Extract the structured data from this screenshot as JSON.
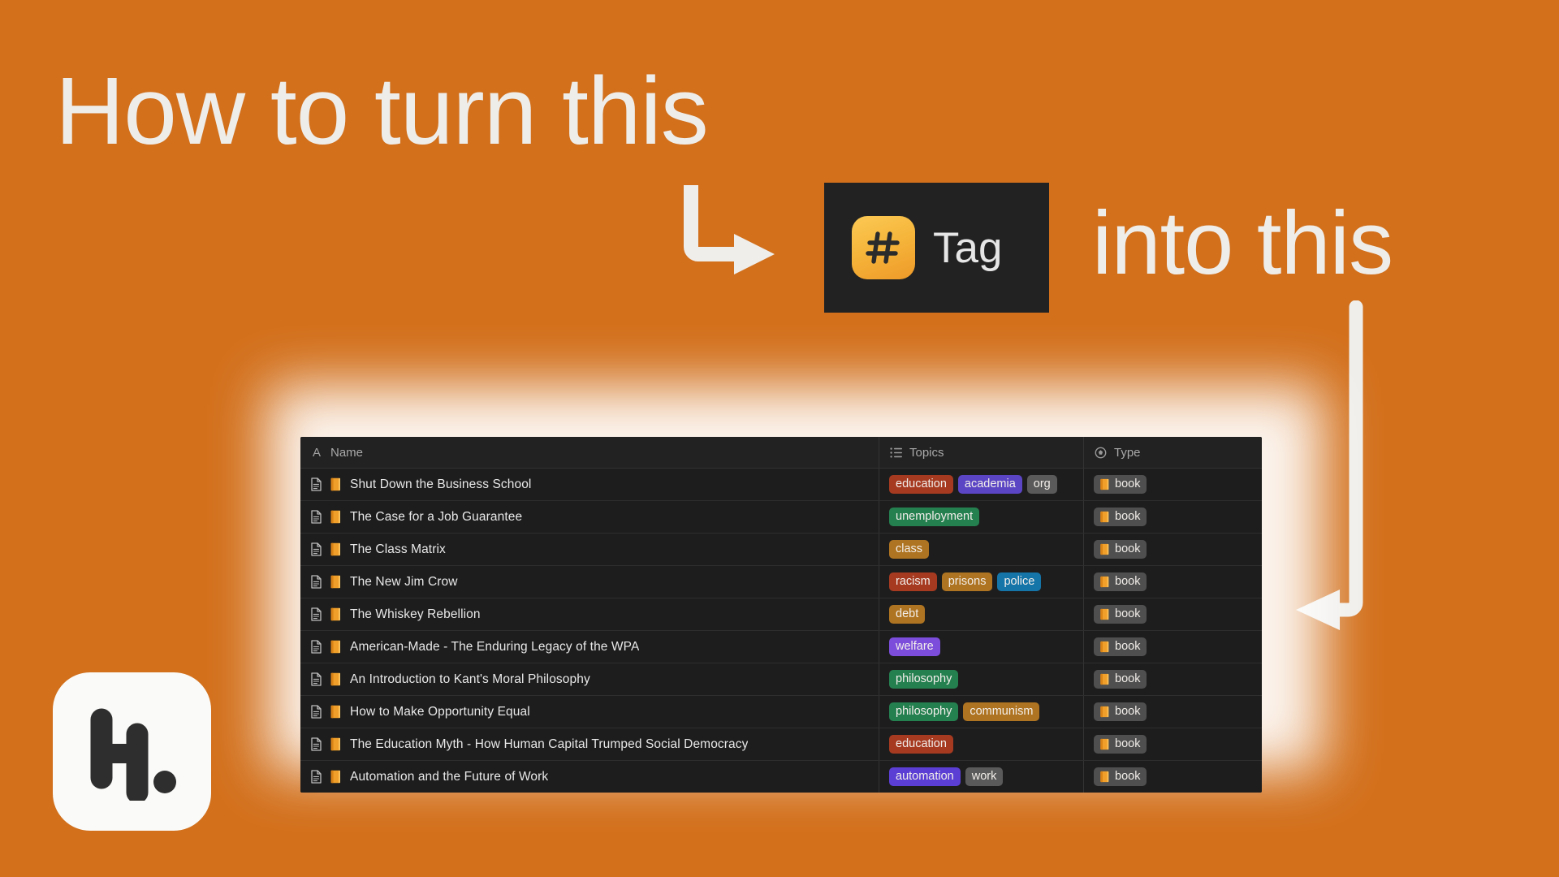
{
  "canvas": {
    "background_color": "#D2701C",
    "title_text_color": "#EFEDEA"
  },
  "headline": {
    "left": "How to turn this",
    "right": "into this"
  },
  "arrows": {
    "left_arrow_name": "elbow-arrow-down-right",
    "right_arrow_name": "elbow-arrow-down-left",
    "color": "#F0EEEB"
  },
  "tag_badge": {
    "icon": "hash-icon",
    "icon_symbol": "#",
    "label": "Tag",
    "chip_bg": "#222222",
    "icon_bg_start": "#FBC954",
    "icon_bg_end": "#EE9A28"
  },
  "logo": {
    "name": "h-dot-logo",
    "letter": "H",
    "dot": ".",
    "bg": "#FAFAF8",
    "fg": "#2E2E2E"
  },
  "table": {
    "columns": [
      {
        "label": "Name",
        "icon": "text-letter-a-icon",
        "type": "title"
      },
      {
        "label": "Topics",
        "icon": "multi-select-icon",
        "type": "multi_select"
      },
      {
        "label": "Type",
        "icon": "select-target-icon",
        "type": "select"
      }
    ],
    "rows": [
      {
        "page_icon": "page-icon",
        "emoji": "closed-book-emoji",
        "name": "Shut Down the Business School",
        "topics": [
          {
            "label": "education",
            "color": "#A63A21"
          },
          {
            "label": "academia",
            "color": "#5B45C4"
          },
          {
            "label": "org",
            "color": "#5A5A5A",
            "truncated": true
          }
        ],
        "type": {
          "label": "book",
          "emoji": "closed-book-emoji",
          "color": "#4F4F4F"
        }
      },
      {
        "page_icon": "page-icon",
        "emoji": "closed-book-emoji",
        "name": "The Case for a Job Guarantee",
        "topics": [
          {
            "label": "unemployment",
            "color": "#258050"
          }
        ],
        "type": {
          "label": "book",
          "emoji": "closed-book-emoji",
          "color": "#4F4F4F"
        }
      },
      {
        "page_icon": "page-icon",
        "emoji": "closed-book-emoji",
        "name": "The Class Matrix",
        "topics": [
          {
            "label": "class",
            "color": "#AF7421"
          }
        ],
        "type": {
          "label": "book",
          "emoji": "closed-book-emoji",
          "color": "#4F4F4F"
        }
      },
      {
        "page_icon": "page-icon",
        "emoji": "closed-book-emoji",
        "name": "The New Jim Crow",
        "topics": [
          {
            "label": "racism",
            "color": "#A63A21"
          },
          {
            "label": "prisons",
            "color": "#AF7421"
          },
          {
            "label": "police",
            "color": "#1574A8"
          }
        ],
        "type": {
          "label": "book",
          "emoji": "closed-book-emoji",
          "color": "#4F4F4F"
        }
      },
      {
        "page_icon": "page-icon",
        "emoji": "closed-book-emoji",
        "name": "The Whiskey Rebellion",
        "topics": [
          {
            "label": "debt",
            "color": "#AF7421"
          }
        ],
        "type": {
          "label": "book",
          "emoji": "closed-book-emoji",
          "color": "#4F4F4F"
        }
      },
      {
        "page_icon": "page-icon",
        "emoji": "closed-book-emoji",
        "name": "American-Made - The Enduring Legacy of the WPA",
        "topics": [
          {
            "label": "welfare",
            "color": "#7C4DDB"
          }
        ],
        "type": {
          "label": "book",
          "emoji": "closed-book-emoji",
          "color": "#4F4F4F"
        }
      },
      {
        "page_icon": "page-icon",
        "emoji": "closed-book-emoji",
        "name": "An Introduction to Kant's Moral Philosophy",
        "topics": [
          {
            "label": "philosophy",
            "color": "#258050"
          }
        ],
        "type": {
          "label": "book",
          "emoji": "closed-book-emoji",
          "color": "#4F4F4F"
        }
      },
      {
        "page_icon": "page-icon",
        "emoji": "closed-book-emoji",
        "name": "How to Make Opportunity Equal",
        "topics": [
          {
            "label": "philosophy",
            "color": "#258050"
          },
          {
            "label": "communism",
            "color": "#AF7421"
          }
        ],
        "type": {
          "label": "book",
          "emoji": "closed-book-emoji",
          "color": "#4F4F4F"
        }
      },
      {
        "page_icon": "page-icon",
        "emoji": "closed-book-emoji",
        "name": "The Education Myth - How Human Capital Trumped Social Democracy",
        "topics": [
          {
            "label": "education",
            "color": "#A63A21"
          }
        ],
        "type": {
          "label": "book",
          "emoji": "closed-book-emoji",
          "color": "#4F4F4F"
        }
      },
      {
        "page_icon": "page-icon",
        "emoji": "closed-book-emoji",
        "name": "Automation and the Future of Work",
        "topics": [
          {
            "label": "automation",
            "color": "#5B3FD4"
          },
          {
            "label": "work",
            "color": "#5A5A5A"
          }
        ],
        "type": {
          "label": "book",
          "emoji": "closed-book-emoji",
          "color": "#4F4F4F"
        }
      }
    ]
  }
}
